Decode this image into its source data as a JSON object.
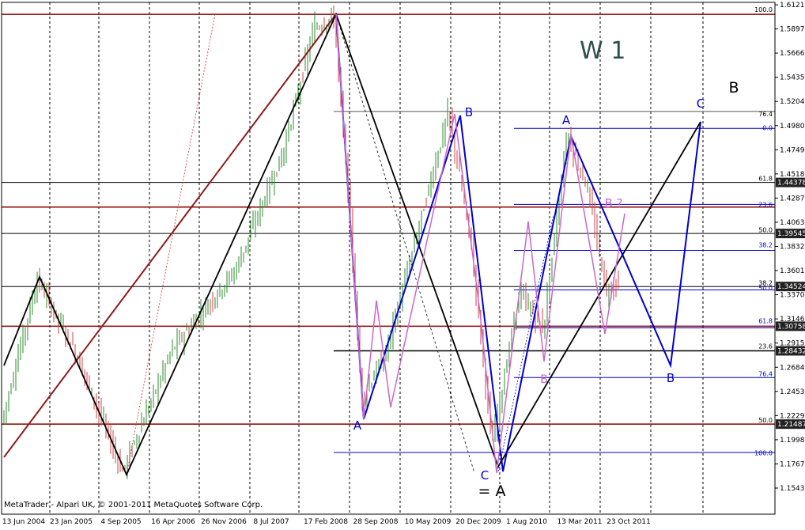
{
  "chart_data": {
    "type": "candlestick",
    "title": "W 1",
    "watermark": "MetaTrader - Alpari UK, © 2001-2011 MetaQuotes Software Corp.",
    "ylim": [
      1.1543,
      1.6121
    ],
    "price_ticks": [
      "1.61210",
      "1.58970",
      "1.56660",
      "1.54350",
      "1.52040",
      "1.49800",
      "1.47490",
      "1.45180",
      "1.42870",
      "1.40630",
      "1.38320",
      "1.36010",
      "1.33700",
      "1.31460",
      "1.29150",
      "1.26840",
      "1.24530",
      "1.22290",
      "1.19980",
      "1.17670",
      "1.15430"
    ],
    "date_ticks": [
      "13 Jun 2004",
      "23 Jan 2005",
      "4 Sep 2005",
      "16 Apr 2006",
      "26 Nov 2006",
      "8 Jul 2007",
      "17 Feb 2008",
      "28 Sep 2008",
      "10 May 2009",
      "20 Dec 2009",
      "1 Aug 2010",
      "13 Mar 2011",
      "23 Oct 2011"
    ],
    "price_markers": [
      {
        "value": "1.44378",
        "price": 1.44378
      },
      {
        "value": "1.39545",
        "price": 1.39545
      },
      {
        "value": "1.34524",
        "price": 1.34524
      },
      {
        "value": "1.30758",
        "price": 1.30758
      },
      {
        "value": "1.28432",
        "price": 1.28432
      },
      {
        "value": "1.21487",
        "price": 1.21487
      }
    ],
    "fib_labels": [
      {
        "text": "100.0",
        "price": 1.607,
        "color": "#000000"
      },
      {
        "text": "76.4",
        "price": 1.508,
        "color": "#000000"
      },
      {
        "text": "0.0",
        "price": 1.495,
        "color": "#0000cc"
      },
      {
        "text": "61.8",
        "price": 1.447,
        "color": "#000000"
      },
      {
        "text": "23.6",
        "price": 1.422,
        "color": "#0000cc"
      },
      {
        "text": "50.0",
        "price": 1.398,
        "color": "#000000"
      },
      {
        "text": "38.2",
        "price": 1.384,
        "color": "#0000cc"
      },
      {
        "text": "38.2",
        "price": 1.348,
        "color": "#000000"
      },
      {
        "text": "50.0",
        "price": 1.343,
        "color": "#0000cc"
      },
      {
        "text": "61.8",
        "price": 1.312,
        "color": "#0000cc"
      },
      {
        "text": "23.6",
        "price": 1.288,
        "color": "#000000"
      },
      {
        "text": "76.4",
        "price": 1.262,
        "color": "#0000cc"
      },
      {
        "text": "50.0",
        "price": 1.218,
        "color": "#000000"
      },
      {
        "text": "100.0",
        "price": 1.187,
        "color": "#0000cc"
      }
    ],
    "wave_labels": [
      {
        "text": "A",
        "color": "#0000cc"
      },
      {
        "text": "B",
        "color": "#0000cc"
      },
      {
        "text": "A",
        "color": "#0000cc"
      },
      {
        "text": "C",
        "color": "#0000cc"
      },
      {
        "text": "B",
        "color": "#0000cc"
      },
      {
        "text": "C",
        "color": "#0000cc"
      },
      {
        "text": "B",
        "color": "#000000"
      },
      {
        "text": "= A",
        "color": "#000000"
      },
      {
        "text": "B ?",
        "color": "#cc66cc"
      },
      {
        "text": "B",
        "color": "#cc66cc"
      }
    ]
  }
}
